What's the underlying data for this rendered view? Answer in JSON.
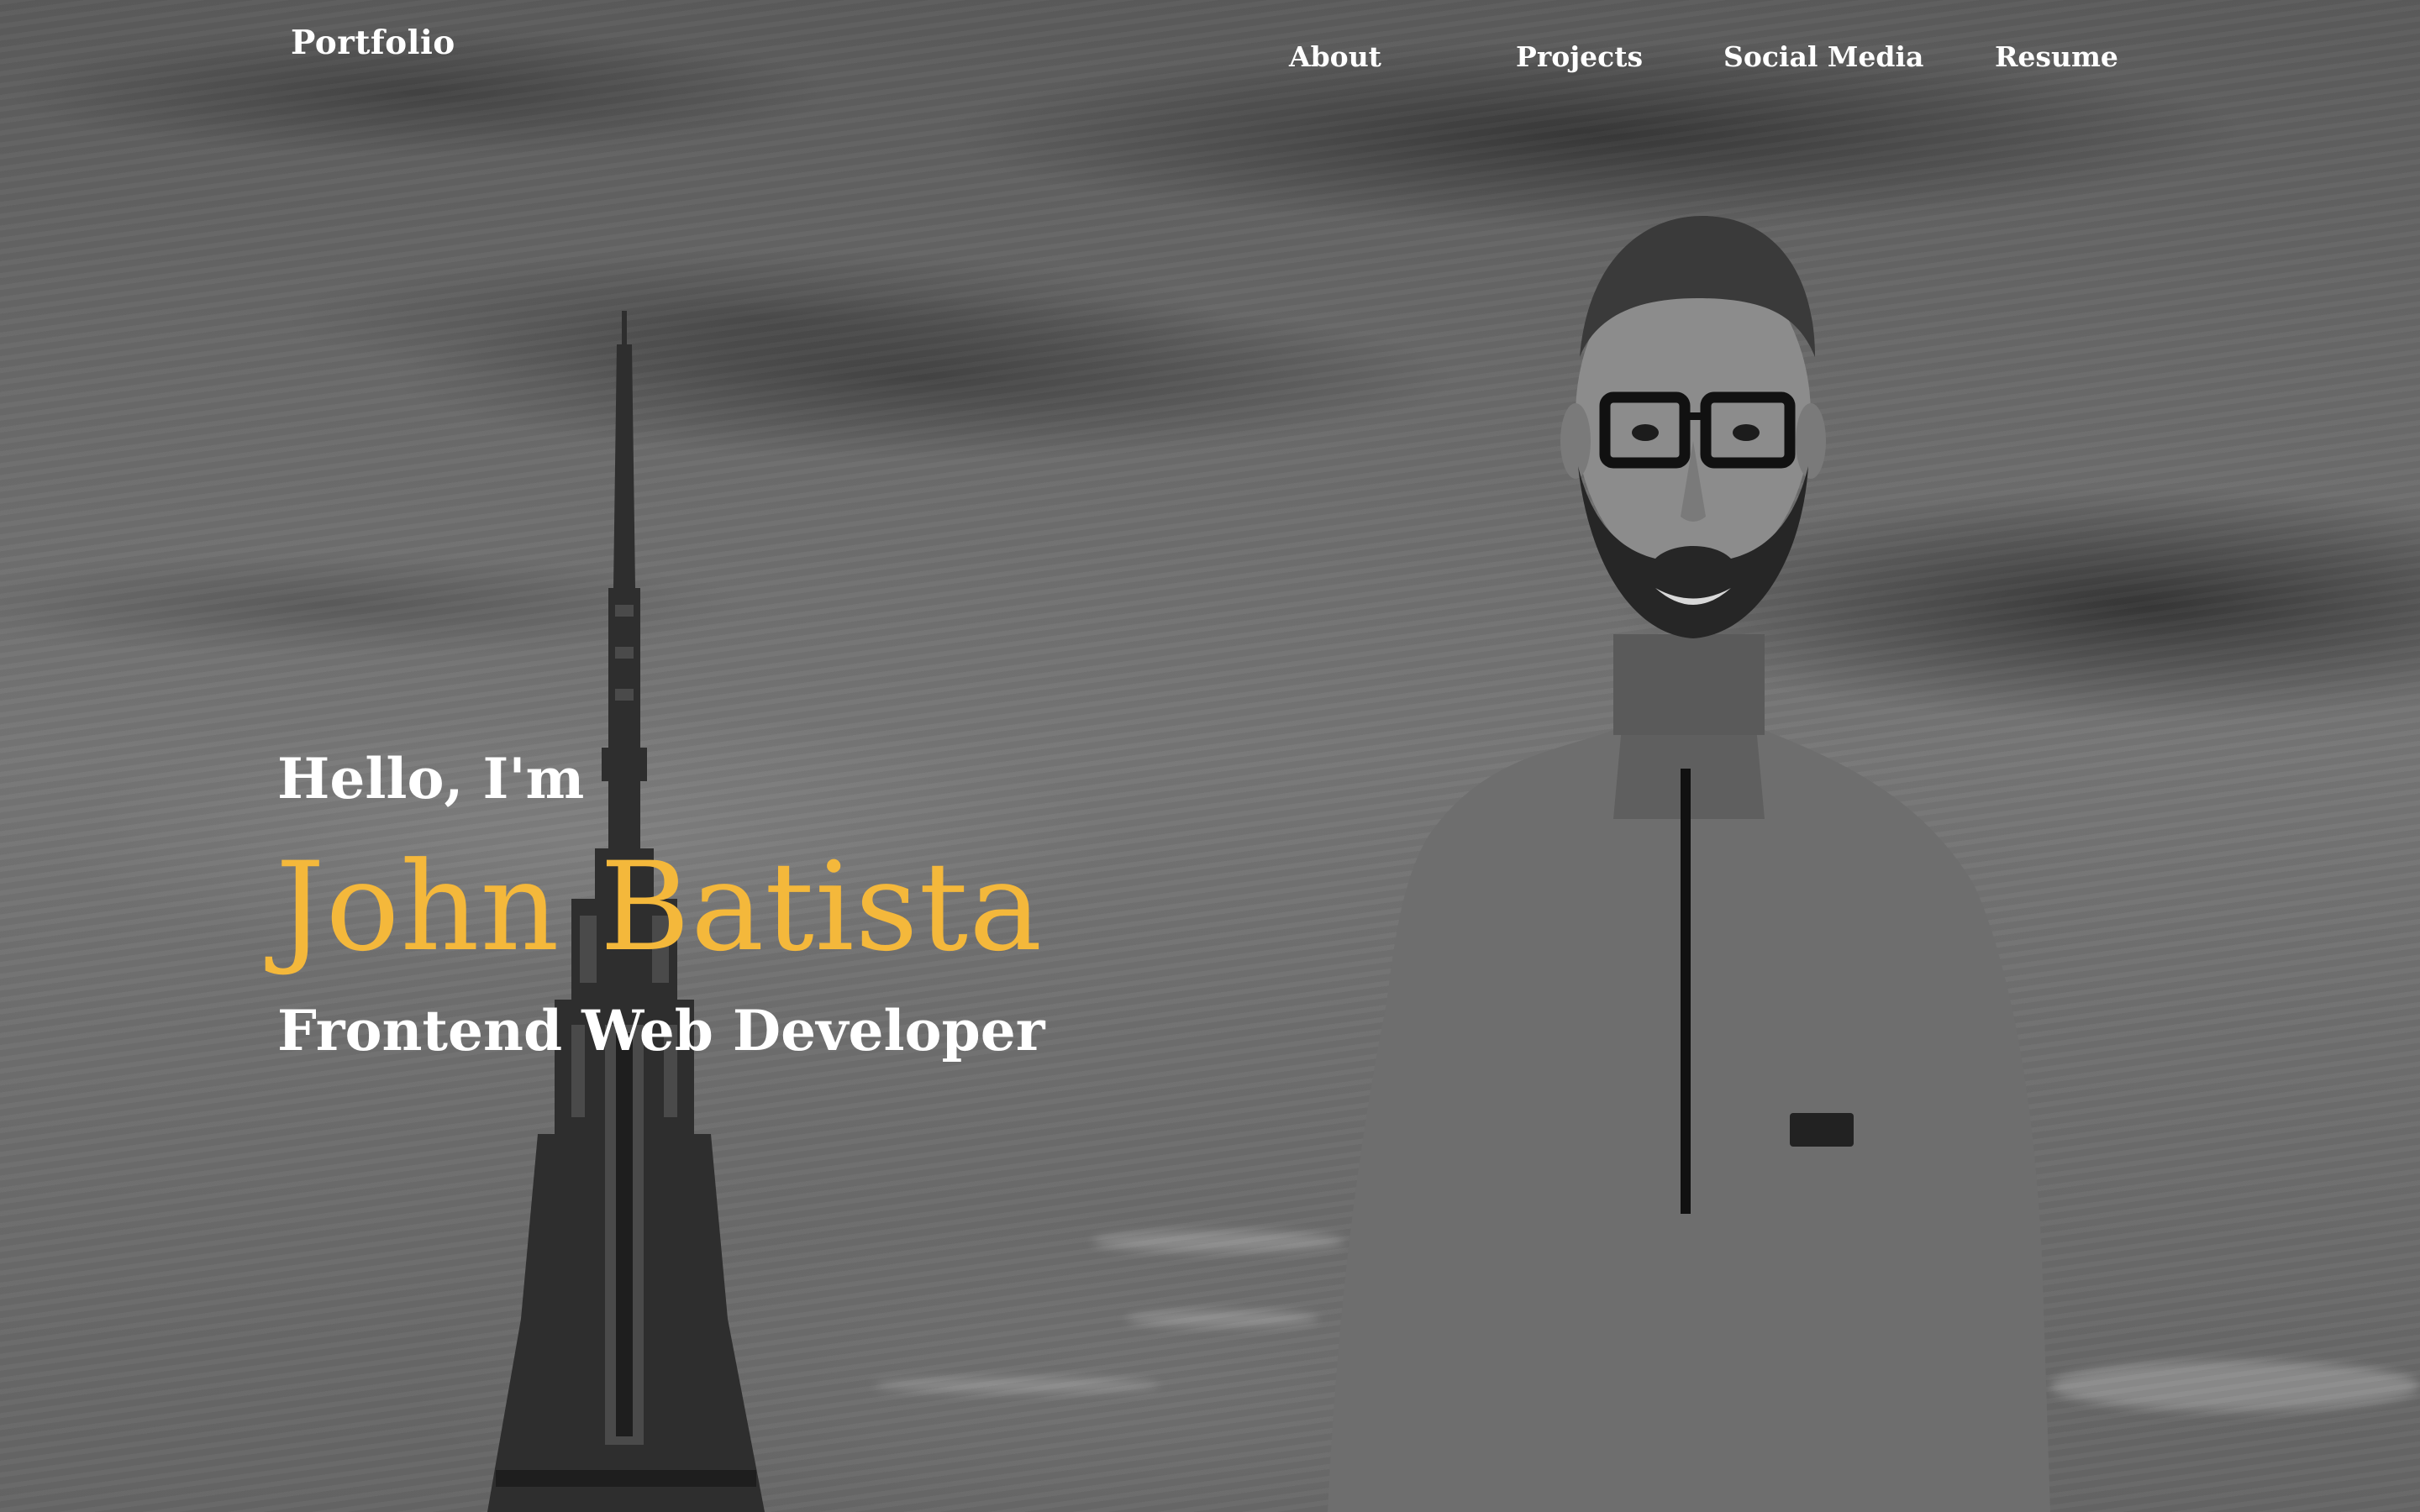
{
  "brand": "Portfolio",
  "nav": {
    "about": "About",
    "projects": "Projects",
    "social_media": "Social Media",
    "resume": "Resume"
  },
  "hero": {
    "greeting": "Hello, I'm",
    "name": "John Batista",
    "role": "Frontend Web Developer"
  },
  "colors": {
    "accent": "#f4b83b",
    "text": "#ffffff"
  }
}
